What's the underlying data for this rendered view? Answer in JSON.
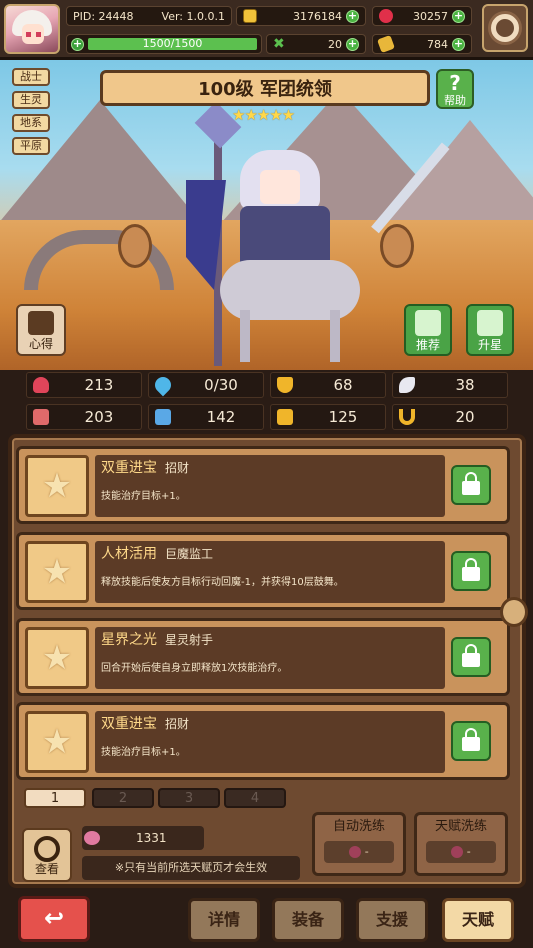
{
  "player": {
    "pid": "PID: 24448",
    "version": "Ver: 1.0.0.1",
    "hp": "1500/1500"
  },
  "currencies": {
    "gold": "3176184",
    "ruby": "30257",
    "clover": "20",
    "ticket": "784"
  },
  "tags": [
    "战士",
    "生灵",
    "地系",
    "平原"
  ],
  "hero": {
    "title": "100级  军团统领",
    "stars": "★★★★★"
  },
  "buttons": {
    "help": "帮助",
    "xinde": "心得",
    "recommend": "推荐",
    "upstar": "升星",
    "search": "查看"
  },
  "stats": [
    {
      "icon": "heart-icon",
      "value": "213",
      "color": "#e0455a"
    },
    {
      "icon": "water-drop-icon",
      "value": "0/30",
      "color": "#4fb6e8"
    },
    {
      "icon": "shield-icon",
      "value": "68",
      "color": "#f0b52a"
    },
    {
      "icon": "wing-icon",
      "value": "38",
      "color": "#e8e8f0"
    },
    {
      "icon": "book-red-icon",
      "value": "203",
      "color": "#e06a6a"
    },
    {
      "icon": "book-blue-icon",
      "value": "142",
      "color": "#5aa8e6"
    },
    {
      "icon": "scroll-icon",
      "value": "125",
      "color": "#f0b52a"
    },
    {
      "icon": "horseshoe-icon",
      "value": "20",
      "color": "#f0b52a"
    }
  ],
  "talents": [
    {
      "name": "双重进宝",
      "source": "招财",
      "desc": "技能治疗目标+1。"
    },
    {
      "name": "人材活用",
      "source": "巨魔监工",
      "desc": "释放技能后使友方目标行动回魔-1，并获得10层鼓舞。"
    },
    {
      "name": "星界之光",
      "source": "星灵射手",
      "desc": "回合开始后使自身立即释放1次技能治疗。"
    },
    {
      "name": "双重进宝",
      "source": "招财",
      "desc": "技能治疗目标+1。"
    }
  ],
  "pages": [
    "1",
    "2",
    "3",
    "4"
  ],
  "gem_count": "1331",
  "hint": "※只有当前所选天赋页才会生效",
  "wash": {
    "auto": {
      "label": "自动洗练",
      "count": "-"
    },
    "talent": {
      "label": "天赋洗练",
      "count": "-"
    }
  },
  "nav": {
    "back": "↩",
    "details": "详情",
    "equip": "装备",
    "support": "支援",
    "talent": "天赋"
  }
}
